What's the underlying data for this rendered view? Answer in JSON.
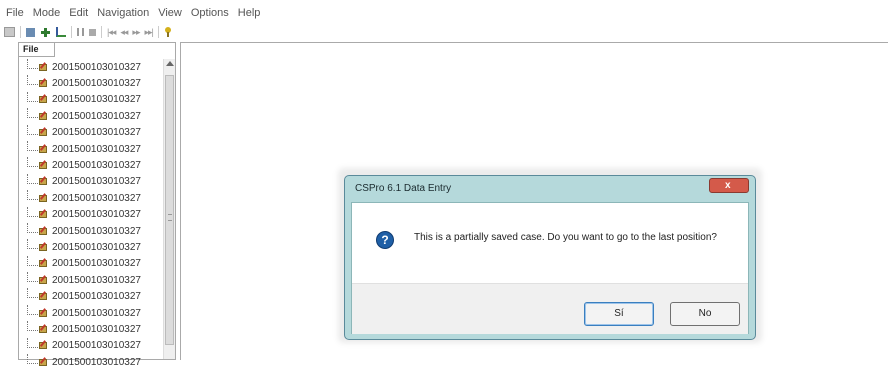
{
  "menu": [
    "File",
    "Mode",
    "Edit",
    "Navigation",
    "View",
    "Options",
    "Help"
  ],
  "toolbar": {
    "icons": [
      "open-icon",
      "save-icon",
      "add-case-icon",
      "modify-case-icon",
      "pause-icon",
      "stop-icon",
      "first-icon",
      "previous-icon",
      "next-icon",
      "last-icon",
      "help-icon"
    ],
    "first": "|◂◂",
    "previous": "◂◂",
    "next": "▸▸",
    "last": "▸▸|"
  },
  "tree": {
    "tab": "File",
    "items": [
      "2001500103010327",
      "2001500103010327",
      "2001500103010327",
      "2001500103010327",
      "2001500103010327",
      "2001500103010327",
      "2001500103010327",
      "2001500103010327",
      "2001500103010327",
      "2001500103010327",
      "2001500103010327",
      "2001500103010327",
      "2001500103010327",
      "2001500103010327",
      "2001500103010327",
      "2001500103010327",
      "2001500103010327",
      "2001500103010327",
      "2001500103010327"
    ]
  },
  "dialog": {
    "title": "CSPro 6.1 Data Entry",
    "close": "x",
    "icon": "?",
    "message": "This is a partially saved case. Do you want to go to the last position?",
    "yes_label": "Sí",
    "no_label": "No"
  },
  "colors": {
    "dialog_frame": "#b5d9db",
    "close_button": "#d45a4a",
    "question_icon": "#1f5fa6"
  }
}
